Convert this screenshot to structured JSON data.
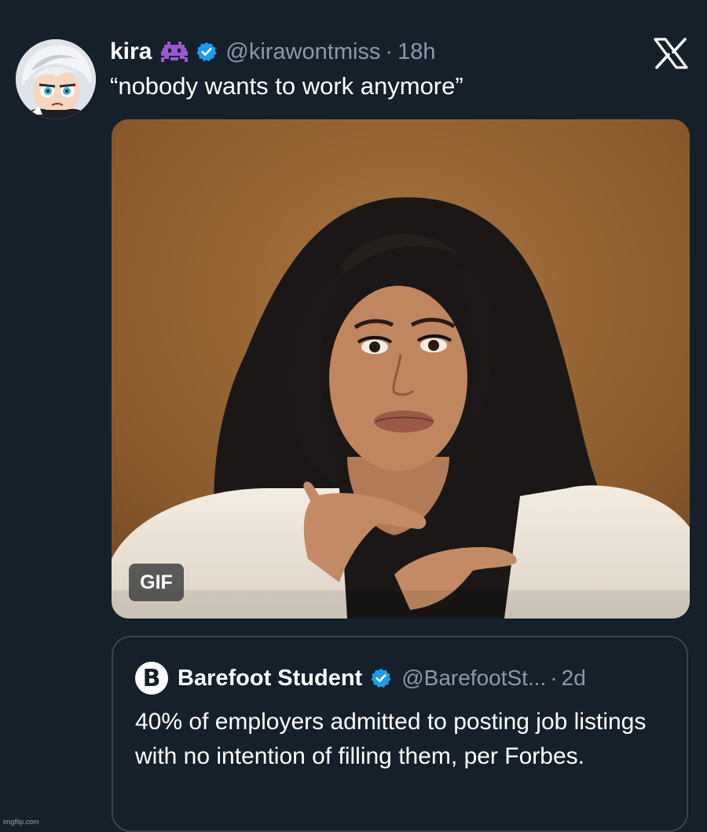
{
  "tweet": {
    "display_name": "kira",
    "handle": "@kirawontmiss",
    "separator": "·",
    "time": "18h",
    "text": "“nobody wants to work anymore”",
    "media": {
      "badge": "GIF"
    }
  },
  "quoted_tweet": {
    "avatar_letter": "B",
    "display_name": "Barefoot Student",
    "handle": "@BarefootSt...",
    "separator": "·",
    "time": "2d",
    "text": "40% of employers admitted to posting job listings with no intention of filling them, per Forbes."
  },
  "watermark": "imgflip.com",
  "colors": {
    "background": "#15202b",
    "verified_blue": "#1d9bf0",
    "secondary_text": "#8b98a5",
    "border": "#38444d"
  },
  "icons": {
    "display_name_emoji": "alien-monster-icon",
    "verified": "verified-badge-icon",
    "platform": "x-logo-icon"
  }
}
